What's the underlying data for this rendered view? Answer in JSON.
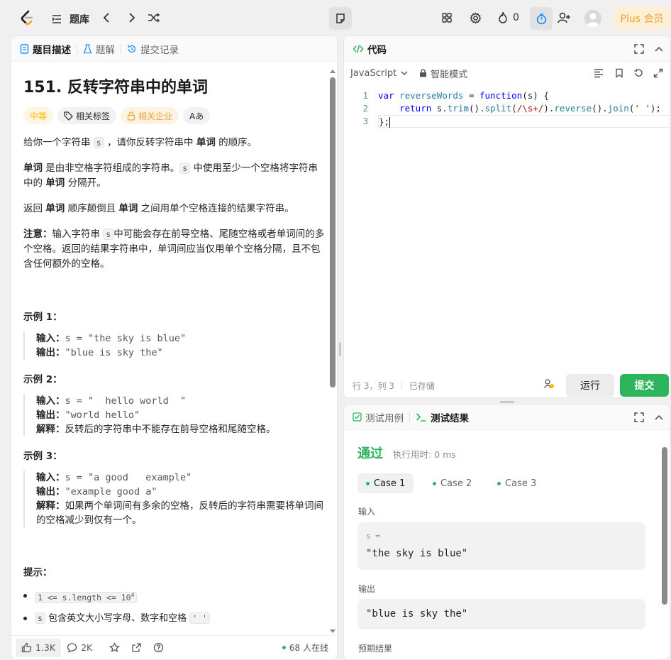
{
  "topbar": {
    "problem_list_label": "题库",
    "fire_count": "0",
    "plus_label": "Plus 会员"
  },
  "left_panel": {
    "tabs": [
      {
        "label": "题目描述",
        "icon": "document-icon"
      },
      {
        "label": "题解",
        "icon": "flask-icon"
      },
      {
        "label": "提交记录",
        "icon": "history-icon"
      }
    ],
    "title": "151. 反转字符串中的单词",
    "difficulty": "中等",
    "tag_related": "相关标签",
    "tag_companies": "相关企业",
    "tag_font": "Aあ",
    "para1": {
      "pre": "给你一个字符串 ",
      "code": "s",
      "mid": " ，请你反转字符串中 ",
      "bold": "单词",
      "post": " 的顺序。"
    },
    "para2": {
      "bold1": "单词",
      "t1": " 是由非空格字符组成的字符串。",
      "code": "s",
      "t2": " 中使用至少一个空格将字符串中的 ",
      "bold2": "单词",
      "t3": " 分隔开。"
    },
    "para3": {
      "t1": "返回 ",
      "bold1": "单词",
      "t2": " 顺序颠倒且 ",
      "bold2": "单词",
      "t3": " 之间用单个空格连接的结果字符串。"
    },
    "para4": {
      "bold": "注意：",
      "t1": "输入字符串 ",
      "code": "s",
      "t2": "中可能会存在前导空格、尾随空格或者单词间的多个空格。返回的结果字符串中，单词间应当仅用单个空格分隔，且不包含任何额外的空格。"
    },
    "examples": [
      {
        "title": "示例 1：",
        "input_label": "输入：",
        "input": "s = \"the sky is blue\"",
        "output_label": "输出：",
        "output": "\"blue is sky the\"",
        "explain_label": "",
        "explain": ""
      },
      {
        "title": "示例 2：",
        "input_label": "输入：",
        "input": "s = \"  hello world  \"",
        "output_label": "输出：",
        "output": "\"world hello\"",
        "explain_label": "解释：",
        "explain": "反转后的字符串中不能存在前导空格和尾随空格。"
      },
      {
        "title": "示例 3：",
        "input_label": "输入：",
        "input": "s = \"a good   example\"",
        "output_label": "输出：",
        "output": "\"example good a\"",
        "explain_label": "解释：",
        "explain": "如果两个单词间有多余的空格，反转后的字符串需要将单词间的空格减少到仅有一个。"
      }
    ],
    "hints_title": "提示：",
    "hint1": "1 <= s.length <= 10",
    "hint1_sup": "4",
    "hint2": {
      "code": "s",
      "text": " 包含英文大小写字母、数字和空格 ",
      "code2": "' '"
    },
    "bottom": {
      "likes": "1.3K",
      "comments": "2K",
      "online": "68 人在线"
    }
  },
  "code_panel": {
    "title": "代码",
    "language": "JavaScript",
    "mode": "智能模式",
    "lines": [
      "1",
      "2",
      "3"
    ],
    "status_pos": "行 3，列 3",
    "status_saved": "已存储",
    "run_label": "运行",
    "submit_label": "提交"
  },
  "result_panel": {
    "tab_cases": "测试用例",
    "tab_result": "测试结果",
    "status": "通过",
    "runtime": "执行用时: 0 ms",
    "cases": [
      "Case 1",
      "Case 2",
      "Case 3"
    ],
    "input_label": "输入",
    "input_var": "s =",
    "input_value": "\"the sky is blue\"",
    "output_label": "输出",
    "output_value": "\"blue is sky the\"",
    "expected_label": "预期结果"
  },
  "colors": {
    "accent_green": "#2db55d",
    "difficulty_yellow": "#ffb800",
    "plus_orange": "#e8a63a"
  }
}
